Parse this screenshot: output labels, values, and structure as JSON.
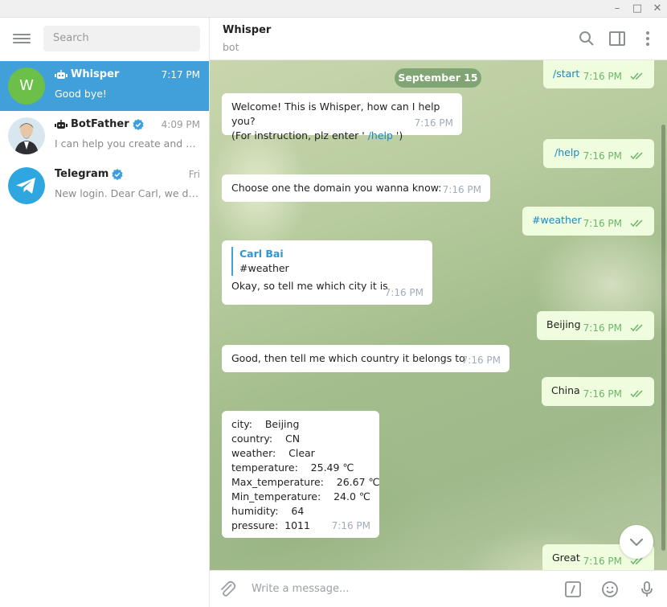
{
  "window": {
    "minimize": "–",
    "maximize": "□",
    "close": "✕"
  },
  "sidebar": {
    "search_placeholder": "Search",
    "chats": [
      {
        "name": "Whisper",
        "avatar_letter": "W",
        "time": "7:17 PM",
        "preview": "Good bye!",
        "is_bot": true,
        "verified": false,
        "active": true
      },
      {
        "name": "BotFather",
        "time": "4:09 PM",
        "preview": "I can help you create and ma...",
        "is_bot": true,
        "verified": true,
        "active": false
      },
      {
        "name": "Telegram",
        "time": "Fri",
        "preview": "New login. Dear Carl, we dete...",
        "is_bot": false,
        "verified": true,
        "active": false
      }
    ]
  },
  "header": {
    "title": "Whisper",
    "subtitle": "bot"
  },
  "date_pill": "September 15",
  "messages": {
    "m1": {
      "text": "/start",
      "time": "7:16 PM"
    },
    "m2": {
      "line1": "Welcome! This is Whisper, how can I help you?",
      "line2_pre": "(For instruction, plz enter ' ",
      "line2_cmd": "/help",
      "line2_post": " ')",
      "time": "7:16 PM"
    },
    "m3": {
      "text": "/help",
      "time": "7:16 PM"
    },
    "m4": {
      "text": "Choose one the domain you wanna know:",
      "time": "7:16 PM"
    },
    "m5": {
      "text": "#weather",
      "time": "7:16 PM"
    },
    "m6": {
      "quote_name": "Carl Bai",
      "quote_text": "#weather",
      "text": "Okay, so tell me which city it is",
      "time": "7:16 PM"
    },
    "m7": {
      "text": "Beijing",
      "time": "7:16 PM"
    },
    "m8": {
      "text": "Good, then tell me which country it belongs to",
      "time": "7:16 PM"
    },
    "m9": {
      "text": "China",
      "time": "7:16 PM"
    },
    "m10": {
      "lines": [
        "city:    Beijing",
        "country:    CN",
        "weather:    Clear",
        "temperature:    25.49 ℃",
        "Max_temperature:    26.67 ℃",
        "Min_temperature:    24.0 ℃",
        "humidity:    64",
        "pressure:  1011"
      ],
      "time": "7:16 PM"
    },
    "m11": {
      "text": "Great",
      "time": "7:16 PM"
    }
  },
  "input": {
    "placeholder": "Write a message..."
  },
  "colors": {
    "accent": "#419fd9",
    "outgoing_bubble": "#effdde",
    "tick_green": "#6cb56b",
    "avatar_green": "#6cc04a"
  }
}
